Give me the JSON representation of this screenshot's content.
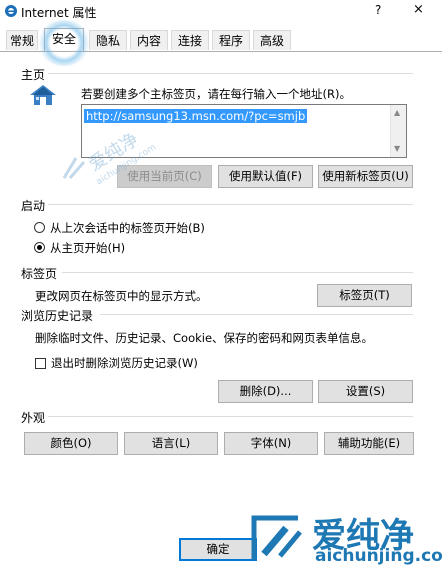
{
  "window": {
    "title": "Internet 属性",
    "help_label": "?",
    "close_label": "×"
  },
  "tabs": [
    "常规",
    "安全",
    "隐私",
    "内容",
    "连接",
    "程序",
    "高级"
  ],
  "active_tab": "安全",
  "home": {
    "header": "主页",
    "instruction": "若要创建多个主标签页，请在每行输入一个地址(R)。",
    "url_value": "http://samsung13.msn.com/?pc=smjb",
    "btn_current": "使用当前页(C)",
    "btn_default": "使用默认值(F)",
    "btn_newtab": "使用新标签页(U)"
  },
  "startup": {
    "header": "启动",
    "option_last_session": "从上次会话中的标签页开始(B)",
    "option_home": "从主页开始(H)",
    "selected": "home"
  },
  "tabs_group": {
    "header": "标签页",
    "description": "更改网页在标签页中的显示方式。",
    "btn_tabs": "标签页(T)"
  },
  "history": {
    "header": "浏览历史记录",
    "description": "删除临时文件、历史记录、Cookie、保存的密码和网页表单信息。",
    "checkbox_label": "退出时删除浏览历史记录(W)",
    "checkbox_checked": false,
    "btn_delete": "删除(D)...",
    "btn_settings": "设置(S)"
  },
  "appearance": {
    "header": "外观",
    "btn_colors": "颜色(O)",
    "btn_languages": "语言(L)",
    "btn_fonts": "字体(N)",
    "btn_accessibility": "辅助功能(E)"
  },
  "footer": {
    "btn_ok": "确定"
  },
  "watermark": {
    "diag_text": "爱纯净",
    "diag_url": "aichunjing.com",
    "brand": "爱纯净",
    "url": "aichunjing.com"
  },
  "colors": {
    "selection": "#3399ff",
    "default_border": "#0078d7",
    "brand": "#1e78b4"
  }
}
